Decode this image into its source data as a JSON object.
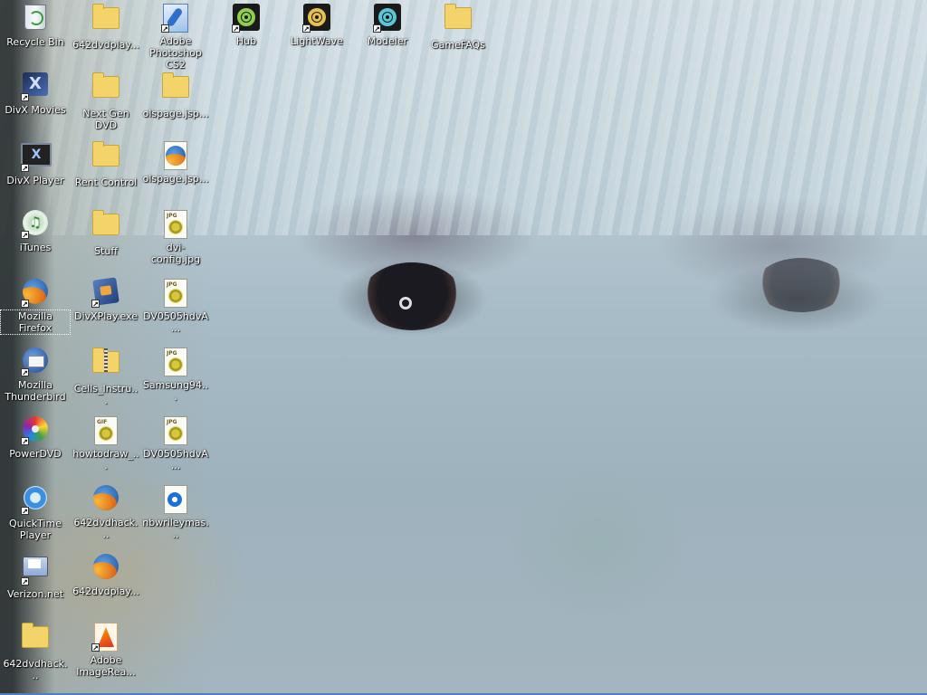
{
  "desktop": {
    "icons": [
      {
        "label": "Recycle Bin",
        "icon": "recycle-bin-icon"
      },
      {
        "label": "642dvdplay...",
        "icon": "folder-icon"
      },
      {
        "label": "Adobe Photoshop CS2",
        "icon": "photoshop-icon"
      },
      {
        "label": "Hub",
        "icon": "lightwave-hub-icon"
      },
      {
        "label": "LightWave",
        "icon": "lightwave-icon"
      },
      {
        "label": "Modeler",
        "icon": "lightwave-modeler-icon"
      },
      {
        "label": "GameFAQs",
        "icon": "folder-icon"
      },
      {
        "label": "DivX Movies",
        "icon": "divx-movies-icon"
      },
      {
        "label": "Next Gen DVD",
        "icon": "folder-icon"
      },
      {
        "label": "olspage.jsp...",
        "icon": "folder-icon"
      },
      {
        "label": "DivX Player",
        "icon": "divx-player-icon"
      },
      {
        "label": "Rent Control",
        "icon": "folder-icon"
      },
      {
        "label": "olspage.jsp...",
        "icon": "firefox-document-icon"
      },
      {
        "label": "iTunes",
        "icon": "itunes-icon"
      },
      {
        "label": "Stuff",
        "icon": "folder-icon"
      },
      {
        "label": "dvi-config.jpg",
        "icon": "jpg-file-icon"
      },
      {
        "label": "Mozilla Firefox",
        "icon": "firefox-icon"
      },
      {
        "label": "DivXPlay.exe",
        "icon": "divxplay-exe-icon"
      },
      {
        "label": "DV0505hdvA...",
        "icon": "jpg-file-icon"
      },
      {
        "label": "Mozilla Thunderbird",
        "icon": "thunderbird-icon"
      },
      {
        "label": "Cells_Instru...",
        "icon": "zip-folder-icon"
      },
      {
        "label": "Samsung94...",
        "icon": "jpg-file-icon"
      },
      {
        "label": "PowerDVD",
        "icon": "powerdvd-icon"
      },
      {
        "label": "howtodraw_...",
        "icon": "gif-file-icon"
      },
      {
        "label": "DV0505hdvA...",
        "icon": "jpg-file-icon"
      },
      {
        "label": "QuickTime Player",
        "icon": "quicktime-icon"
      },
      {
        "label": "642dvdhack...",
        "icon": "firefox-document-icon"
      },
      {
        "label": "nbwrileymas...",
        "icon": "media-player-file-icon"
      },
      {
        "label": "Verizon.net",
        "icon": "verizon-icon"
      },
      {
        "label": "642dvdplay...",
        "icon": "firefox-document-icon"
      },
      {
        "label": "642dvdhack...",
        "icon": "folder-icon"
      },
      {
        "label": "Adobe ImageRea...",
        "icon": "imageready-icon"
      }
    ],
    "file_tags": {
      "jpg": "JPG",
      "gif": "GIF"
    },
    "colors": {
      "taskbar_edge": "#4f7fc0",
      "label_text": "#ffffff"
    }
  }
}
